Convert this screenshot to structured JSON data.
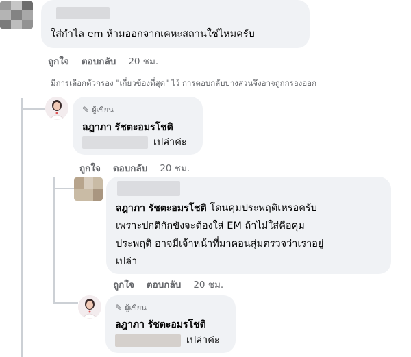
{
  "comment1": {
    "text": "ใส่กำไล em ห้ามออกจากเคหะสถานใช่ไหมครับ",
    "actions": {
      "like": "ถูกใจ",
      "reply": "ตอบกลับ",
      "time": "20 ชม."
    }
  },
  "filter_notice": "มีการเลือกตัวกรอง \"เกี่ยวข้องที่สุด\" ไว้ การตอบกลับบางส่วนจึงอาจถูกกรองออก",
  "reply1": {
    "author_badge": "ผู้เขียน",
    "name": "ลฎาภา รัชตะอมรโชติ",
    "text": "เปล่าค่ะ",
    "actions": {
      "like": "ถูกใจ",
      "reply": "ตอบกลับ",
      "time": "20 ชม."
    }
  },
  "reply2": {
    "mention": "ลฎาภา รัชตะอมรโชติ",
    "text_first": "โดนคุมประพฤติเหรอครับ",
    "text_rest": [
      "เพราะปกติกักขังจะต้องใส่ EM ถ้าไม่ใส่คือคุม",
      "ประพฤติ อาจมีเจ้าหน้าที่มาคอนสุ่มตรวจว่าเราอยู่",
      "เปล่า"
    ],
    "actions": {
      "like": "ถูกใจ",
      "reply": "ตอบกลับ",
      "time": "20 ชม."
    }
  },
  "reply3": {
    "author_badge": "ผู้เขียน",
    "name": "ลฎาภา รัชตะอมรโชติ",
    "text": "เปล่าค่ะ"
  }
}
